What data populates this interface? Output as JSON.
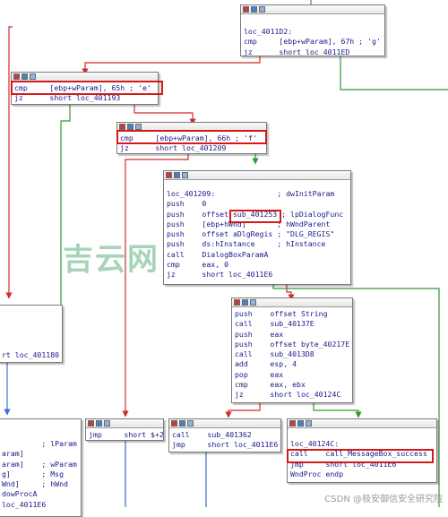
{
  "blocks": {
    "top": {
      "lines": [
        {
          "text": "loc_4011D2:"
        },
        {
          "text": "cmp     [ebp+wParam], 67h ; 'g'"
        },
        {
          "text": "jz      short loc_4011ED"
        }
      ]
    },
    "b65": {
      "lines": [
        {
          "text": "cmp     [ebp+wParam], 65h ; 'e'"
        },
        {
          "text": "jz      short loc_401193"
        }
      ]
    },
    "b66": {
      "lines": [
        {
          "text": "cmp     [ebp+wParam], 66h ; 'f'"
        },
        {
          "text": "jz      short loc_401209"
        }
      ]
    },
    "b209": {
      "lines": [
        {
          "text": "loc_401209:              ; dwInitParam"
        },
        {
          "text": "push    0"
        },
        {
          "text": "push    offset sub_401253 ; lpDialogFunc"
        },
        {
          "text": "push    [ebp+hWnd]       ; hWndParent"
        },
        {
          "text": "push    offset aDlgRegis ; \"DLG_REGIS\""
        },
        {
          "text": "push    ds:hInstance     ; hInstance"
        },
        {
          "text": "call    DialogBoxParamA"
        },
        {
          "text": "cmp     eax, 0"
        },
        {
          "text": "jz      short loc_4011E6"
        }
      ]
    },
    "bstr": {
      "lines": [
        {
          "text": "push    offset String"
        },
        {
          "text": "call    sub_40137E"
        },
        {
          "text": "push    eax"
        },
        {
          "text": "push    offset byte_40217E"
        },
        {
          "text": "call    sub_4013D8"
        },
        {
          "text": "add     esp, 4"
        },
        {
          "text": "pop     eax"
        },
        {
          "text": "cmp     eax, ebx"
        },
        {
          "text": "jz      short loc_40124C"
        }
      ]
    },
    "bleft_mid": {
      "lines": [
        {
          "text": "rt loc_401180"
        }
      ]
    },
    "bjmp": {
      "lines": [
        {
          "text": "jmp     short $+2"
        }
      ]
    },
    "bcall": {
      "lines": [
        {
          "text": "call    sub_401362"
        },
        {
          "text": "jmp     short loc_4011E6"
        }
      ]
    },
    "b24c": {
      "lines": [
        {
          "text": "loc_40124C:"
        },
        {
          "text": "call    call_MessageBox_success"
        },
        {
          "text": "jmp     short loc_4011E6"
        },
        {
          "text": "WndProc endp"
        }
      ]
    },
    "bleft_bot": {
      "lines": [
        {
          "text": "         ; lParam"
        },
        {
          "text": "aram]"
        },
        {
          "text": "aram]    ; wParam"
        },
        {
          "text": "g]       ; Msg"
        },
        {
          "text": "Wnd]     ; hWnd"
        },
        {
          "text": "dowProcA"
        },
        {
          "text": "loc_4011E6"
        }
      ]
    }
  },
  "watermark": "吉云网",
  "footer": "CSDN @极安御信安全研究院",
  "colors": {
    "edge_green": "#2e9b2e",
    "edge_red": "#d12b2b",
    "edge_blue": "#3b6fcf",
    "highlight": "#d81818"
  }
}
